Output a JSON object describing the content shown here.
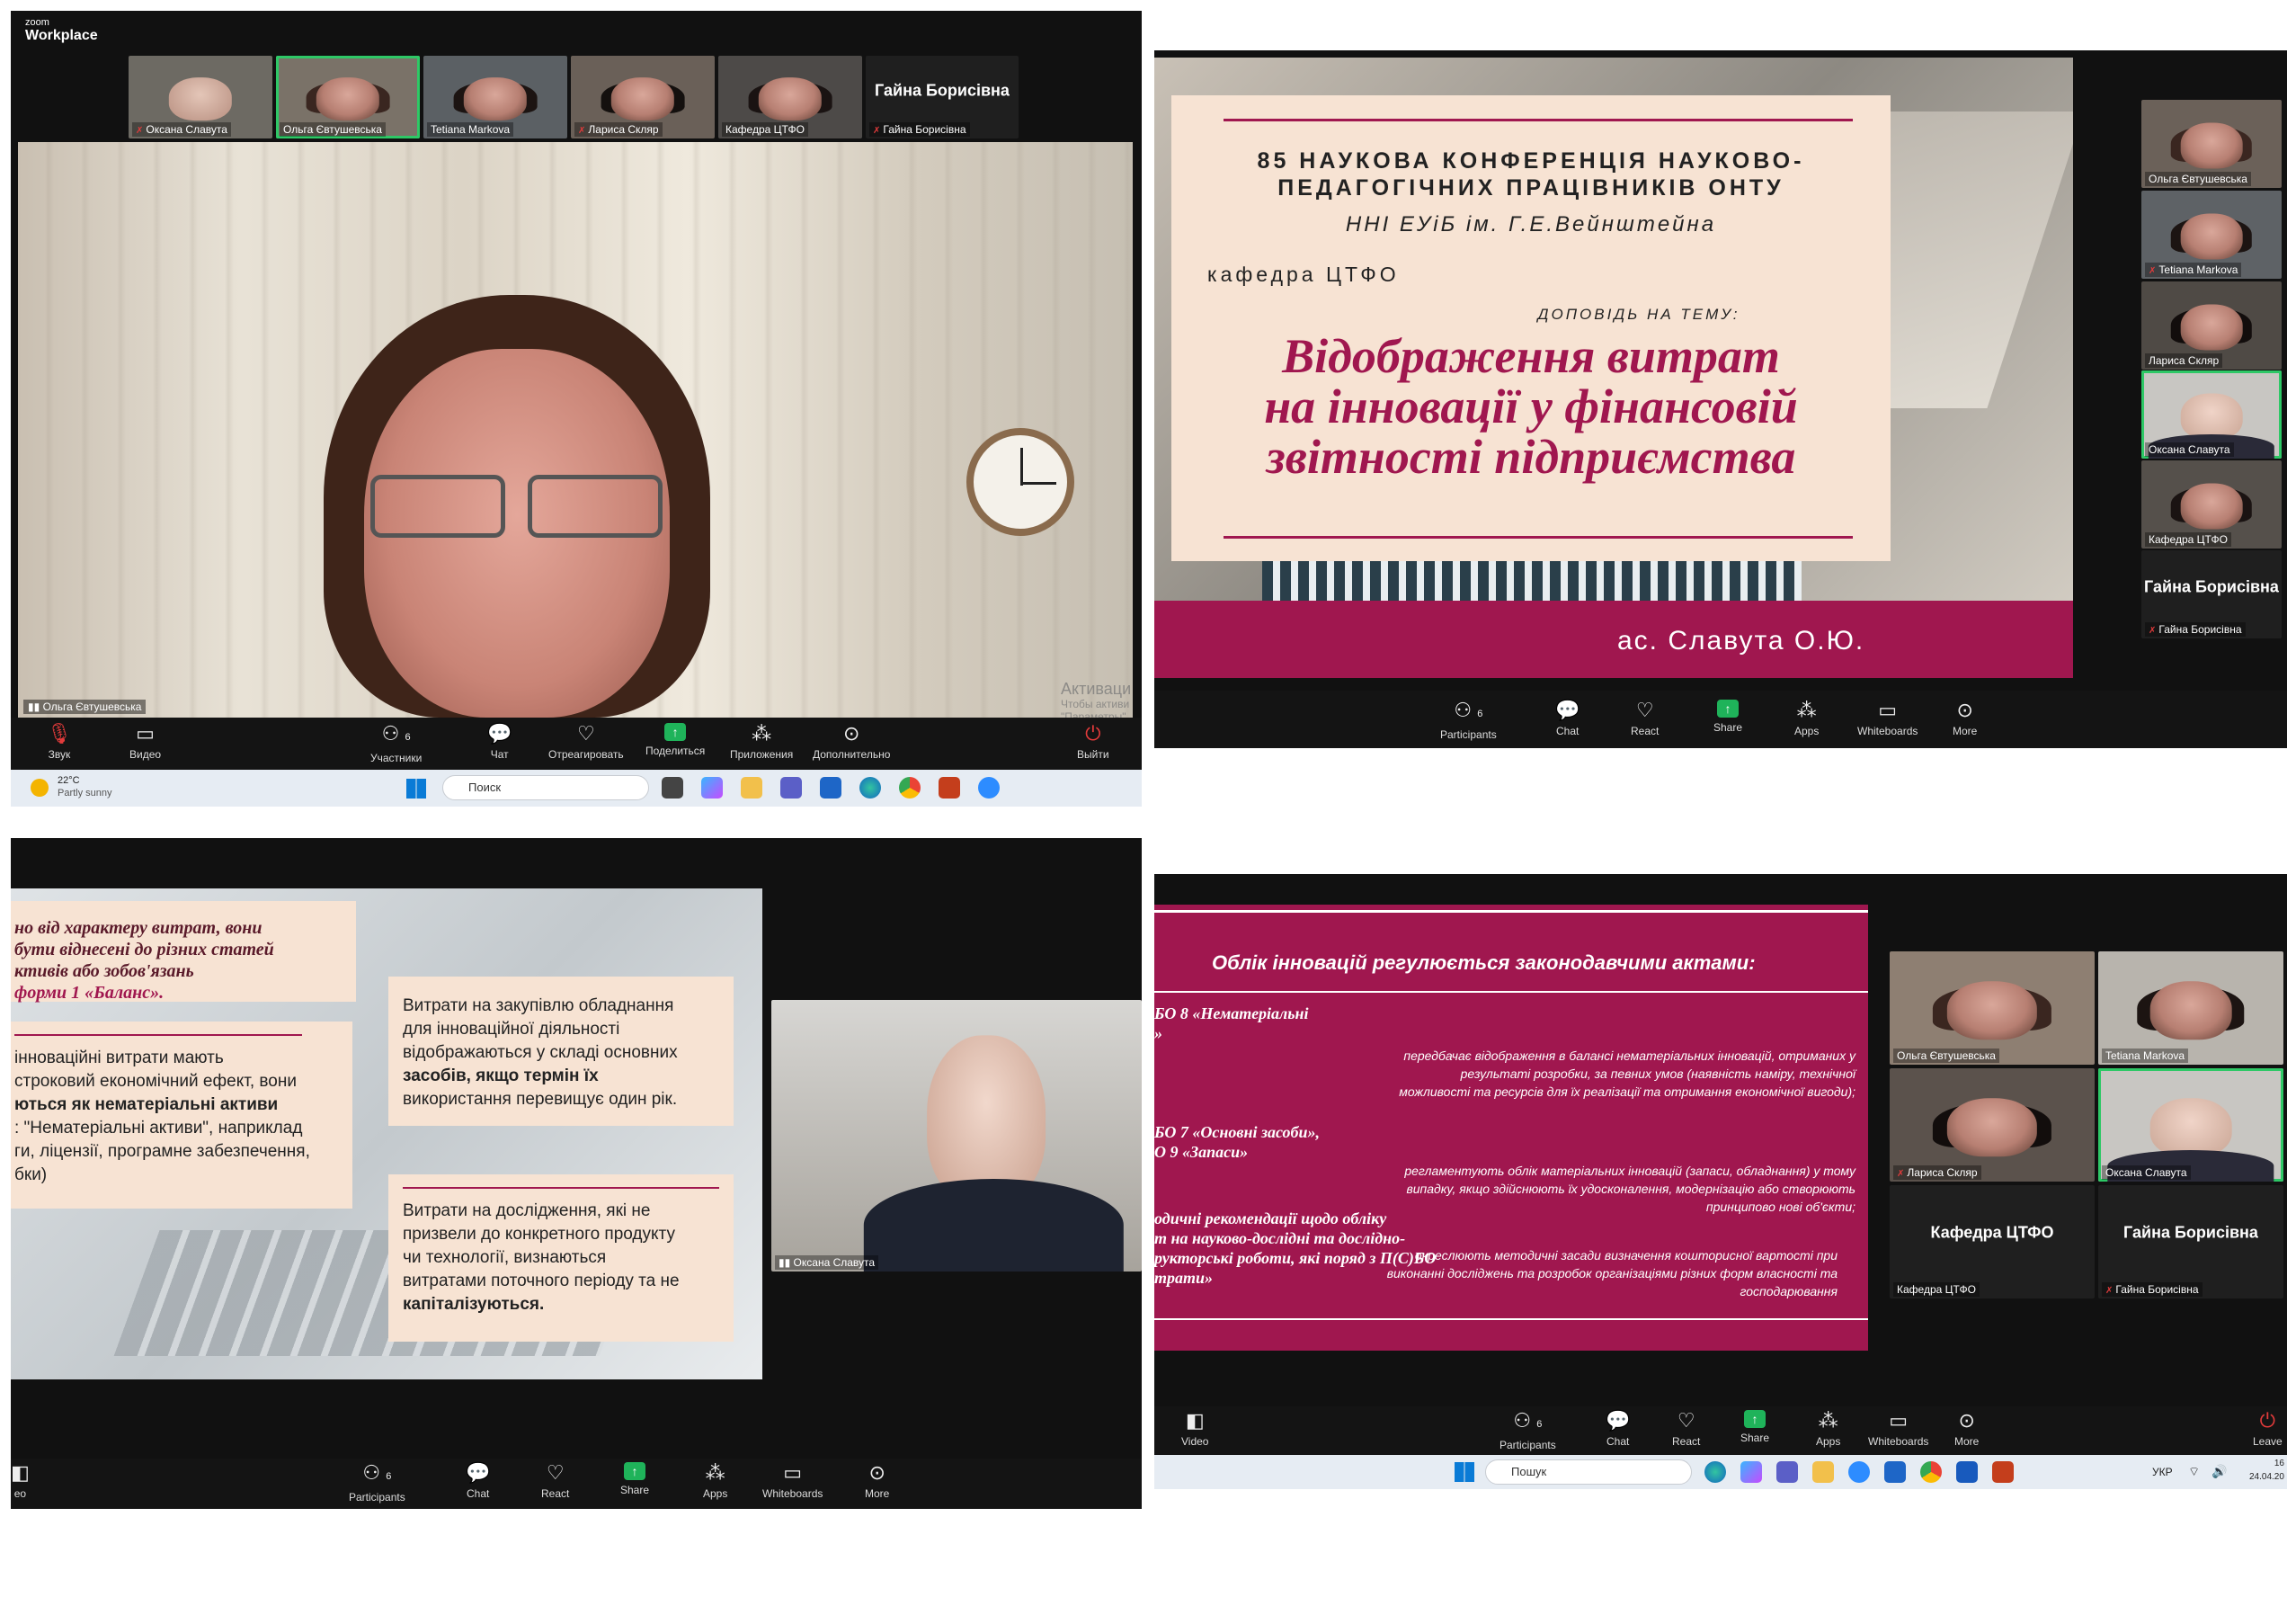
{
  "q1": {
    "brand_top": "zoom",
    "brand_bottom": "Workplace",
    "strip": [
      {
        "name": "Оксана Славута",
        "muted": true
      },
      {
        "name": "Ольга Євтушевська",
        "muted": false
      },
      {
        "name": "Tetiana Markova",
        "muted": false
      },
      {
        "name": "Лариса Скляр",
        "muted": true
      },
      {
        "name": "Кафедра ЦТФО",
        "muted": false
      },
      {
        "name": "Гайна Борисівна",
        "muted": true,
        "big_label": "Гайна Борисівна"
      }
    ],
    "speaker_name": "Ольга Євтушевська",
    "activate_line1": "Активаци",
    "activate_line2": "Чтобы активи",
    "activate_line3": "\"Параметры\".",
    "toolbar": {
      "audio": "Звук",
      "video": "Видео",
      "participants": "Участники",
      "participants_count": "6",
      "chat": "Чат",
      "react": "Отреагировать",
      "share": "Поделиться",
      "apps": "Приложения",
      "more": "Дополнительно",
      "leave": "Выйти"
    },
    "taskbar": {
      "temp": "22°C",
      "weather": "Partly sunny",
      "search": "Поиск"
    }
  },
  "q2": {
    "slide": {
      "line1": "85 НАУКОВА КОНФЕРЕНЦІЯ НАУКОВО-",
      "line2": "ПЕДАГОГІЧНИХ ПРАЦІВНИКІВ ОНТУ",
      "line3": "ННІ ЕУіБ ім. Г.Е.Вейнштейна",
      "dept": "кафедра ЦТФО",
      "topic_label": "ДОПОВІДЬ НА ТЕМУ:",
      "title1": "Відображення витрат",
      "title2": "на інновації у фінансовій",
      "title3": "звітності підприємства",
      "author": "ас. Славута О.Ю."
    },
    "sidebar": [
      {
        "name": "Ольга Євтушевська",
        "muted": false
      },
      {
        "name": "Tetiana Markova",
        "muted": true
      },
      {
        "name": "Лариса Скляр",
        "muted": false
      },
      {
        "name": "Оксана Славута",
        "muted": false
      },
      {
        "name": "Кафедра ЦТФО",
        "muted": false
      },
      {
        "name": "Гайна Борисівна",
        "muted": true,
        "big_label": "Гайна Борисівна"
      }
    ],
    "toolbar": {
      "participants": "Participants",
      "participants_count": "6",
      "chat": "Chat",
      "react": "React",
      "share": "Share",
      "apps": "Apps",
      "whiteboards": "Whiteboards",
      "more": "More"
    }
  },
  "q3": {
    "left_card_lines": [
      "но від характеру витрат, вони",
      "бути віднесені до різних статей",
      "ктивів або зобов'язань",
      "форми 1 «Баланс»."
    ],
    "left_card2_lines": [
      "інноваційні витрати мають",
      "строковий економічний ефект, вони",
      "ються як нематеріальні активи",
      ": \"Нематеріальні активи\", наприклад",
      "ги, ліцензії, програмне забезпечення,",
      "бки)"
    ],
    "card_a": [
      "Витрати на закупівлю обладнання",
      "для інноваційної діяльності",
      "відображаються у складі основних",
      "засобів, якщо термін їх",
      "використання перевищує один рік."
    ],
    "card_b": [
      "Витрати на дослідження, які не",
      "призвели до конкретного продукту",
      "чи технології, визнаються",
      "витратами поточного періоду та не",
      "капіталізуються."
    ],
    "speaker_name": "Оксана Славута",
    "toolbar": {
      "video_partial": "eo",
      "participants": "Participants",
      "participants_count": "6",
      "chat": "Chat",
      "react": "React",
      "share": "Share",
      "apps": "Apps",
      "whiteboards": "Whiteboards",
      "more": "More"
    }
  },
  "q4": {
    "heading": "Облік інновацій регулюється законодавчими актами:",
    "left_lines": [
      "БО 8 «Нематеріальні",
      "»",
      "БО 7 «Основні засоби»,",
      "О 9 «Запаси»",
      "одичні рекомендації щодо обліку",
      "т на науково-дослідні та дослідно-",
      "рукторські роботи, які поряд з П(С)БО",
      "трати»"
    ],
    "para1": [
      "передбачає відображення в балансі нематеріальних інновацій, отриманих у",
      "результаті розробки, за певних умов (наявність наміру, технічної",
      "можливості та ресурсів для їх реалізації та отримання економічної вигоди);"
    ],
    "para2": [
      "регламентують облік матеріальних інновацій (запаси, обладнання) у тому",
      "випадку, якщо здійснюють їх удосконалення, модернізацію або створюють",
      "принципово нові об'єкти;"
    ],
    "para3": [
      "окреслюють методичні засади визначення кошторисної вартості при",
      "виконанні досліджень та розробок організаціями різних форм власності та",
      "господарювання"
    ],
    "grid": [
      {
        "name": "Ольга Євтушевська",
        "muted": false
      },
      {
        "name": "Tetiana Markova",
        "muted": false
      },
      {
        "name": "Лариса Скляр",
        "muted": true
      },
      {
        "name": "Оксана Славута",
        "muted": false
      },
      {
        "name": "Кафедра ЦТФО",
        "muted": false,
        "big_label": "Кафедра ЦТФО"
      },
      {
        "name": "Гайна Борисівна",
        "muted": true,
        "big_label": "Гайна Борисівна"
      }
    ],
    "toolbar": {
      "video": "Video",
      "participants": "Participants",
      "participants_count": "6",
      "chat": "Chat",
      "react": "React",
      "share": "Share",
      "apps": "Apps",
      "whiteboards": "Whiteboards",
      "more": "More",
      "leave": "Leave"
    },
    "taskbar": {
      "search": "Пошук",
      "lang": "УКР",
      "time": "16",
      "date": "24.04.20"
    }
  },
  "colors": {
    "accent_magenta": "#a0174f",
    "cream": "#f7e3d3",
    "zoom_green": "#1fb35a",
    "active_border": "#2ec866"
  }
}
